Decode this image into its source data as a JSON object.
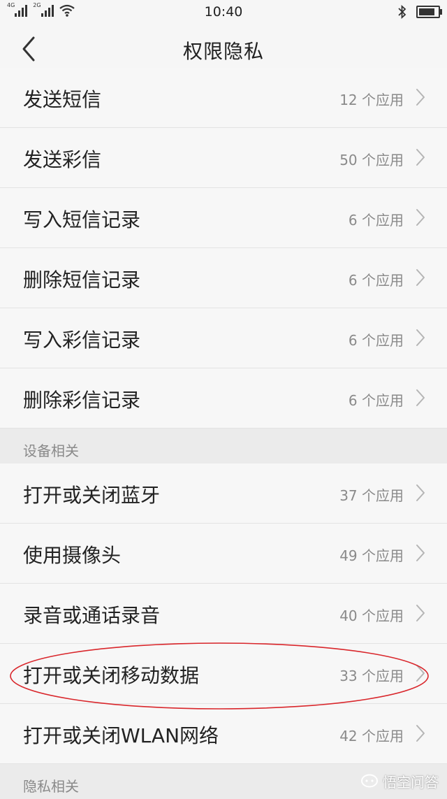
{
  "status_bar": {
    "sim1_label": "4G",
    "sim2_label": "2G",
    "time": "10:40",
    "icons": [
      "signal-icon",
      "wifi-icon",
      "bluetooth-icon",
      "battery-icon"
    ],
    "battery_level": 0.9
  },
  "header": {
    "title": "权限隐私",
    "back_icon": "chevron-left-icon"
  },
  "rows_sms": [
    {
      "label": "发送短信",
      "count": "12 个应用"
    },
    {
      "label": "发送彩信",
      "count": "50 个应用"
    },
    {
      "label": "写入短信记录",
      "count": "6 个应用"
    },
    {
      "label": "删除短信记录",
      "count": "6 个应用"
    },
    {
      "label": "写入彩信记录",
      "count": "6 个应用"
    },
    {
      "label": "删除彩信记录",
      "count": "6 个应用"
    }
  ],
  "section_device": {
    "label": "设备相关"
  },
  "rows_device": [
    {
      "label": "打开或关闭蓝牙",
      "count": "37 个应用"
    },
    {
      "label": "使用摄像头",
      "count": "49 个应用"
    },
    {
      "label": "录音或通话录音",
      "count": "40 个应用"
    },
    {
      "label": "打开或关闭移动数据",
      "count": "33 个应用"
    },
    {
      "label": "打开或关闭WLAN网络",
      "count": "42 个应用"
    }
  ],
  "section_privacy": {
    "label": "隐私相关"
  },
  "highlight_color": "#d9262b",
  "watermark": {
    "text": "悟空问答"
  }
}
